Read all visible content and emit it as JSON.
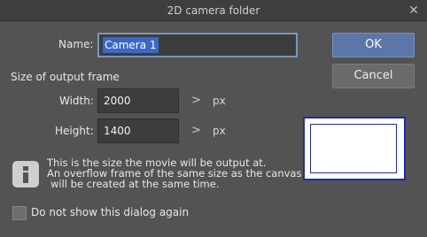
{
  "window": {
    "title": "2D camera folder",
    "close_glyph": "✕"
  },
  "name": {
    "label": "Name:",
    "value": "Camera 1"
  },
  "output_frame": {
    "section_label": "Size of output frame",
    "width_label": "Width:",
    "width_value": "2000",
    "height_label": "Height:",
    "height_value": "1400",
    "chevron_glyph": ">",
    "unit": "px"
  },
  "buttons": {
    "ok": "OK",
    "cancel": "Cancel"
  },
  "info": {
    "icon": "info-icon",
    "lines": [
      "This is the size the movie will be output at.",
      "An overflow frame of the same size as the canvas",
      "will be created at the same time."
    ]
  },
  "dont_show": {
    "label": "Do not show this dialog again",
    "checked": false
  },
  "colors": {
    "background": "#535353",
    "ok_button": "#5c76a8",
    "preview_border": "#1f28b8",
    "selection": "#3a68c7"
  }
}
